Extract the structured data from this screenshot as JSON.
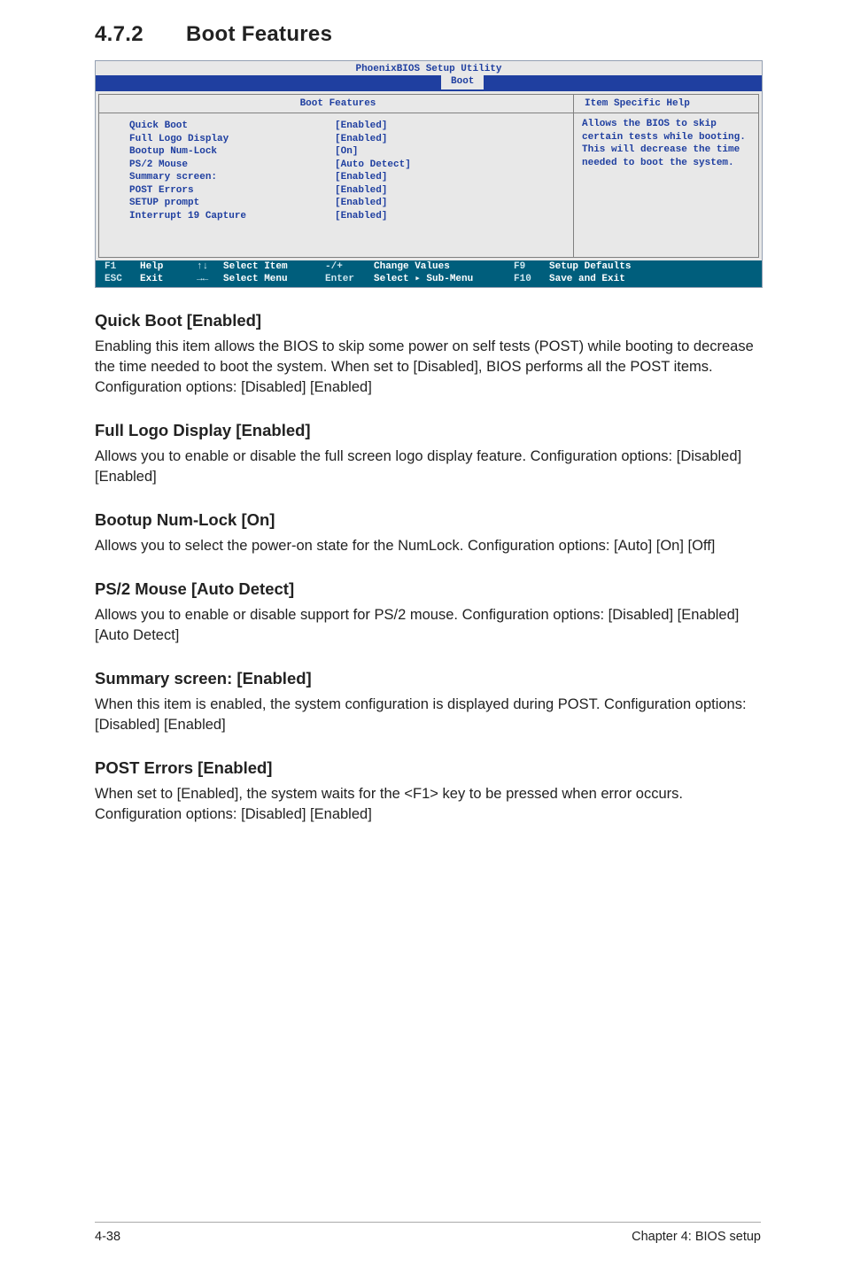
{
  "heading": {
    "number": "4.7.2",
    "title": "Boot Features"
  },
  "bios": {
    "window_title": "PhoenixBIOS Setup Utility",
    "active_tab": "Boot",
    "left_panel_title": "Boot Features",
    "right_panel_title": "Item Specific Help",
    "help_text": "Allows the BIOS to skip certain tests while booting. This will decrease the time needed to boot the system.",
    "options": [
      {
        "label": "Quick Boot",
        "value": "[Enabled]"
      },
      {
        "label": "Full Logo Display",
        "value": "[Enabled]"
      },
      {
        "label": "Bootup Num-Lock",
        "value": "[On]"
      },
      {
        "label": "PS/2 Mouse",
        "value": "[Auto Detect]"
      },
      {
        "label": "Summary screen:",
        "value": "[Enabled]"
      },
      {
        "label": "POST Errors",
        "value": "[Enabled]"
      },
      {
        "label": "SETUP prompt",
        "value": "[Enabled]"
      },
      {
        "label": "Interrupt 19 Capture",
        "value": "[Enabled]"
      }
    ],
    "footer": {
      "f1": "F1",
      "help": "Help",
      "esc": "ESC",
      "exit": "Exit",
      "updn": "↑↓",
      "select_item": "Select Item",
      "lr": "→←",
      "select_menu": "Select Menu",
      "pm": "-/+",
      "change_values": "Change Values",
      "enter": "Enter",
      "select_submenu": "Select ▸ Sub-Menu",
      "f9": "F9",
      "setup_defaults": "Setup Defaults",
      "f10": "F10",
      "save_exit": "Save and Exit"
    }
  },
  "sections": [
    {
      "title": "Quick Boot [Enabled]",
      "body": "Enabling this item allows the BIOS to skip some power on self tests (POST) while booting to decrease the time needed to boot the system. When set to [Disabled], BIOS performs all the POST items. Configuration options: [Disabled] [Enabled]"
    },
    {
      "title": "Full Logo Display [Enabled]",
      "body": "Allows you to enable or disable the full screen logo display feature. Configuration options: [Disabled] [Enabled]"
    },
    {
      "title": "Bootup Num-Lock [On]",
      "body": "Allows you to select the power-on state for the NumLock. Configuration options: [Auto] [On] [Off]"
    },
    {
      "title": "PS/2 Mouse [Auto Detect]",
      "body": "Allows you to enable or disable support for PS/2 mouse. Configuration options: [Disabled] [Enabled] [Auto Detect]"
    },
    {
      "title": "Summary screen: [Enabled]",
      "body": "When this item is enabled, the system configuration is displayed during POST. Configuration options: [Disabled] [Enabled]"
    },
    {
      "title": "POST Errors [Enabled]",
      "body": "When set to [Enabled], the system waits for the <F1> key to be pressed when error occurs. Configuration options: [Disabled] [Enabled]"
    }
  ],
  "page_footer": {
    "left": "4-38",
    "right": "Chapter 4: BIOS setup"
  }
}
